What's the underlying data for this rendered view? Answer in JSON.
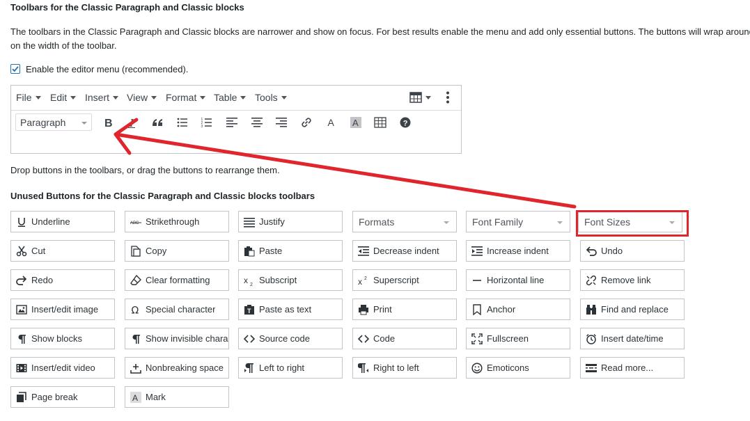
{
  "section_title": "Toolbars for the Classic Paragraph and Classic blocks",
  "description_line1": "The toolbars in the Classic Paragraph and Classic blocks are narrower and show on focus. For best results enable the menu and add only essential buttons. The buttons will wrap around d",
  "description_line2": "on the width of the toolbar.",
  "enable_menu_label": "Enable the editor menu (recommended).",
  "enable_menu_checked": true,
  "menubar": {
    "file": "File",
    "edit": "Edit",
    "insert": "Insert",
    "view": "View",
    "format": "Format",
    "table": "Table",
    "tools": "Tools"
  },
  "toolbar": {
    "paragraph_select": "Paragraph",
    "icons": [
      "bold-icon",
      "italic-icon",
      "blockquote-icon",
      "bullet-list-icon",
      "numbered-list-icon",
      "align-left-icon",
      "align-center-icon",
      "align-right-icon",
      "link-icon",
      "text-color-icon",
      "background-color-icon",
      "table-icon",
      "help-icon"
    ]
  },
  "drop_instructions": "Drop buttons in the toolbars, or drag the buttons to rearrange them.",
  "unused_title": "Unused Buttons for the Classic Paragraph and Classic blocks toolbars",
  "unused": {
    "underline": "Underline",
    "strikethrough": "Strikethrough",
    "justify": "Justify",
    "formats": "Formats",
    "font_family": "Font Family",
    "font_sizes": "Font Sizes",
    "cut": "Cut",
    "copy": "Copy",
    "paste": "Paste",
    "decrease_indent": "Decrease indent",
    "increase_indent": "Increase indent",
    "undo": "Undo",
    "redo": "Redo",
    "clear_formatting": "Clear formatting",
    "subscript": "Subscript",
    "superscript": "Superscript",
    "horizontal_line": "Horizontal line",
    "remove_link": "Remove link",
    "insert_image": "Insert/edit image",
    "special_character": "Special character",
    "paste_as_text": "Paste as text",
    "print": "Print",
    "anchor": "Anchor",
    "find_replace": "Find and replace",
    "show_blocks": "Show blocks",
    "show_invisible": "Show invisible chara...",
    "source_code": "Source code",
    "code": "Code",
    "fullscreen": "Fullscreen",
    "insert_datetime": "Insert date/time",
    "insert_video": "Insert/edit video",
    "nonbreaking_space": "Nonbreaking space",
    "left_to_right": "Left to right",
    "right_to_left": "Right to left",
    "emoticons": "Emoticons",
    "read_more": "Read more...",
    "page_break": "Page break",
    "mark": "Mark"
  },
  "colors": {
    "highlight": "#e0252d",
    "checkbox": "#2271b1",
    "border": "#c3c4c7"
  }
}
